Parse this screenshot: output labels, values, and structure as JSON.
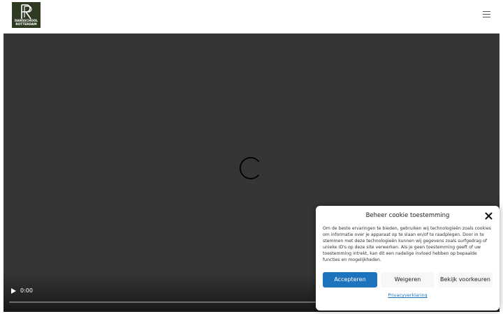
{
  "header": {
    "logo_line1": "DANSSCHOOL",
    "logo_line2": "ROTTERDAM",
    "menu_icon": "hamburger-menu-icon"
  },
  "video": {
    "time": "0:00",
    "play_icon": "play-icon",
    "loading_icon": "loading-spinner-icon",
    "progress": 0
  },
  "cookie_dialog": {
    "title": "Beheer cookie toestemming",
    "close_icon": "close-icon",
    "body": "Om de beste ervaringen te bieden, gebruiken wij technologieën zoals cookies om informatie over je apparaat op te slaan en/of te raadplegen. Door in te stemmen met deze technologieën kunnen wij gegevens zoals surfgedrag of unieke ID's op deze site verwerken. Als je geen toestemming geeft of uw toestemming intrekt, kan dit een nadelige invloed hebben op bepaalde functies en mogelijkheden.",
    "accept_label": "Accepteren",
    "deny_label": "Weigeren",
    "preferences_label": "Bekijk voorkeuren",
    "privacy_label": "Privacyverklaring",
    "accent_color": "#1e73be"
  }
}
